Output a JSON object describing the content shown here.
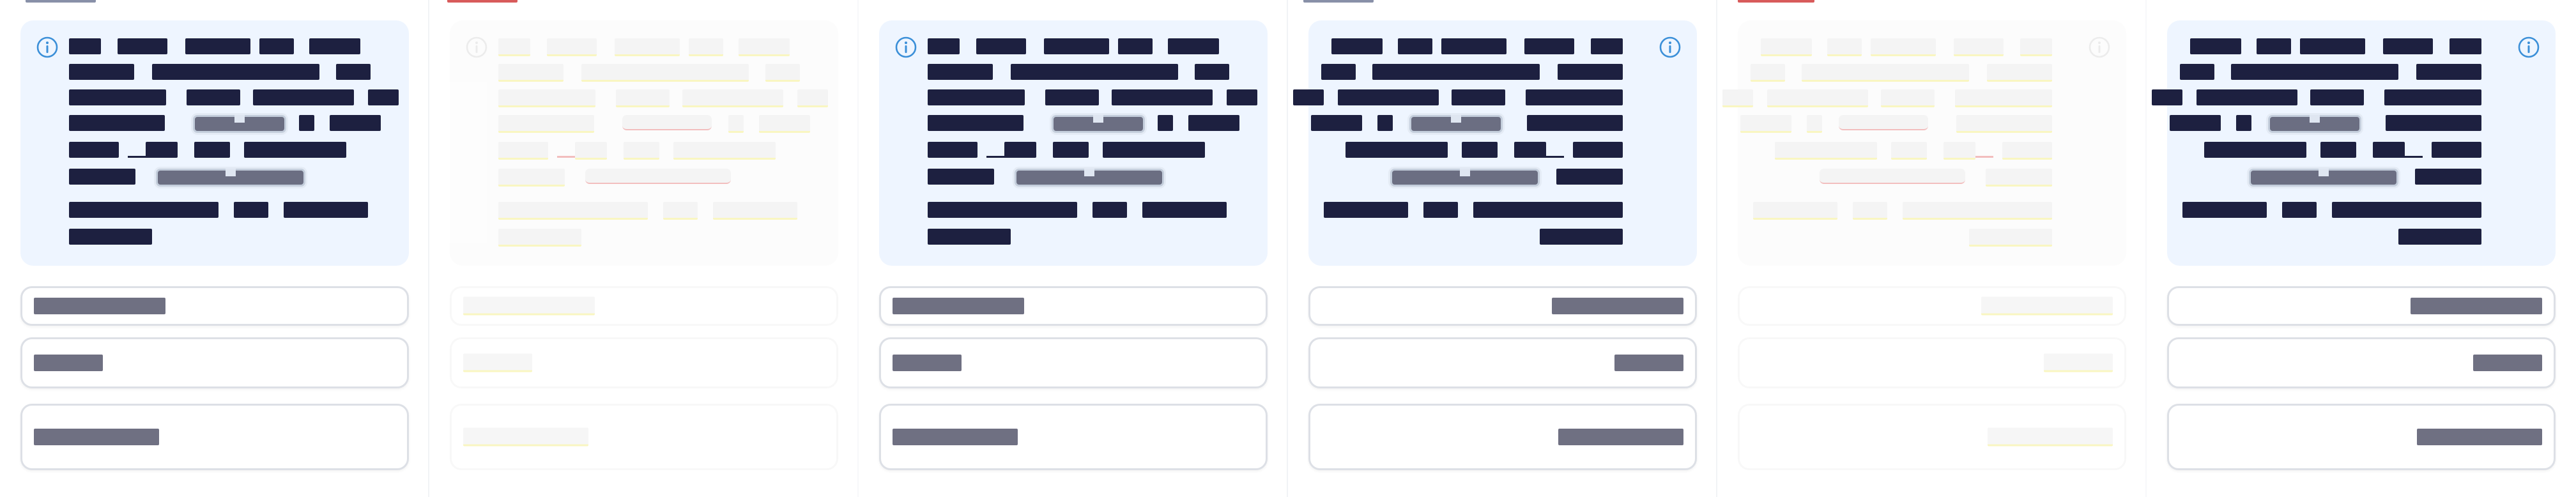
{
  "screen": {
    "colors": {
      "card_background": "#eef5ff",
      "text_block": "#1d2040",
      "row_bar": "#6f7082",
      "info_icon": "#3b8fd8",
      "accent_mark": "#d85b5b",
      "faded_underline": "#f5ef8f"
    },
    "icons": {
      "info": "info-circle-icon"
    },
    "columns": [
      {
        "id": "col-1",
        "direction": "ltr",
        "state": "active",
        "icon_side": "left"
      },
      {
        "id": "col-2",
        "direction": "ltr",
        "state": "faded",
        "icon_side": "left"
      },
      {
        "id": "col-3",
        "direction": "ltr",
        "state": "active",
        "icon_side": "left"
      },
      {
        "id": "col-4",
        "direction": "rtl",
        "state": "active",
        "icon_side": "right"
      },
      {
        "id": "col-5",
        "direction": "rtl",
        "state": "faded",
        "icon_side": "right"
      },
      {
        "id": "col-6",
        "direction": "rtl",
        "state": "active",
        "icon_side": "right"
      }
    ]
  }
}
